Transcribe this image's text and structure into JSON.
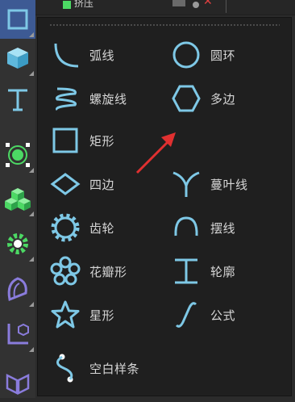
{
  "colors": {
    "accent_blue": "#3d5a94",
    "icon_cyan": "#7ec8e6",
    "palette_green": "#4cd964",
    "palette_purple": "#8a7cdc",
    "annotation_red": "#e03030"
  },
  "top_row": {
    "name": "挤压"
  },
  "palette": [
    {
      "icon": "spline-tool-icon",
      "active": true
    },
    {
      "icon": "cube-icon"
    },
    {
      "icon": "text-icon"
    },
    {
      "icon": "null-object-icon"
    },
    {
      "icon": "cloner-icon"
    },
    {
      "icon": "gear-deformer-icon"
    },
    {
      "icon": "bend-deformer-icon"
    },
    {
      "icon": "axis-icon"
    },
    {
      "icon": "morph-icon"
    }
  ],
  "menu": {
    "items": [
      {
        "label": "弧线",
        "icon": "arc-icon"
      },
      {
        "label": "圆环",
        "icon": "circle-icon"
      },
      {
        "label": "螺旋线",
        "icon": "helix-icon"
      },
      {
        "label": "多边",
        "icon": "polygon-icon"
      },
      {
        "label": "矩形",
        "icon": "rectangle-icon"
      },
      {
        "label": "四边",
        "icon": "diamond-icon"
      },
      {
        "label": "蔓叶线",
        "icon": "cissoid-icon"
      },
      {
        "label": "齿轮",
        "icon": "cog-icon"
      },
      {
        "label": "摆线",
        "icon": "cycloid-icon"
      },
      {
        "label": "花瓣形",
        "icon": "flower-icon"
      },
      {
        "label": "轮廓",
        "icon": "profile-icon"
      },
      {
        "label": "星形",
        "icon": "star-icon"
      },
      {
        "label": "公式",
        "icon": "formula-icon"
      },
      {
        "label": "空白样条",
        "icon": "empty-spline-icon"
      }
    ]
  }
}
